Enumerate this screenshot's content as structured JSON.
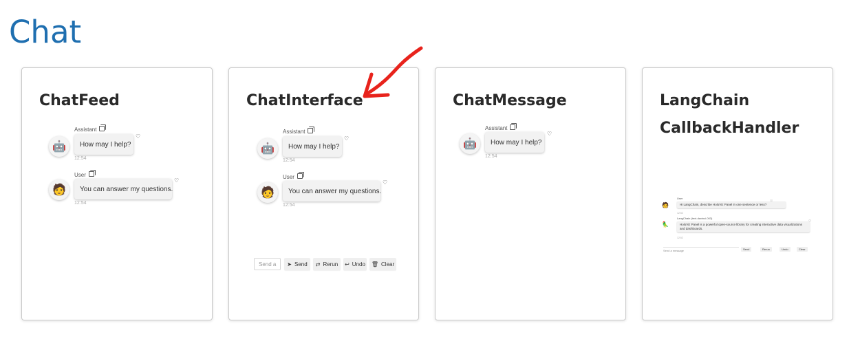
{
  "page": {
    "title": "Chat"
  },
  "cards": [
    {
      "title": "ChatFeed",
      "messages": [
        {
          "author": "Assistant",
          "text": "How may I help?",
          "time": "12:54",
          "avatar_icon": "robot-face-icon"
        },
        {
          "author": "User",
          "text": "You can answer my questions.",
          "time": "12:54",
          "avatar_icon": "person-face-icon"
        }
      ]
    },
    {
      "title": "ChatInterface",
      "messages": [
        {
          "author": "Assistant",
          "text": "How may I help?",
          "time": "12:54",
          "avatar_icon": "robot-face-icon"
        },
        {
          "author": "User",
          "text": "You can answer my questions.",
          "time": "12:54",
          "avatar_icon": "person-face-icon"
        }
      ],
      "input": {
        "placeholder": "Send a"
      },
      "buttons": [
        {
          "label": "Send",
          "icon": "send-icon"
        },
        {
          "label": "Rerun",
          "icon": "rerun-icon"
        },
        {
          "label": "Undo",
          "icon": "undo-icon"
        },
        {
          "label": "Clear",
          "icon": "trash-icon"
        }
      ]
    },
    {
      "title": "ChatMessage",
      "messages": [
        {
          "author": "Assistant",
          "text": "How may I help?",
          "time": "12:54",
          "avatar_icon": "robot-face-icon"
        }
      ]
    },
    {
      "title_line1": "LangChain",
      "title_line2": "CallbackHandler",
      "preview": {
        "messages": [
          {
            "author": "User",
            "text": "Hi LangChain, describe HoloViz Panel in one sentence or less?",
            "time": "12:52",
            "avatar_icon": "person-face-icon"
          },
          {
            "author": "LangChain (text-davinci-003)",
            "text": "HoloViz Panel is a powerful open-source library for creating interactive data visualizations and dashboards.",
            "time": "12:52",
            "avatar_icon": "parrot-icon"
          }
        ],
        "input_placeholder": "Send a message",
        "buttons": [
          "Send",
          "Rerun",
          "Undo",
          "Clear"
        ]
      }
    }
  ],
  "annotation": {
    "color": "#e8231c",
    "icon": "red-arrow-annotation"
  },
  "colors": {
    "title": "#1f6fb0",
    "card_border": "#c9c9c9",
    "bubble_bg": "#f2f2f2"
  }
}
